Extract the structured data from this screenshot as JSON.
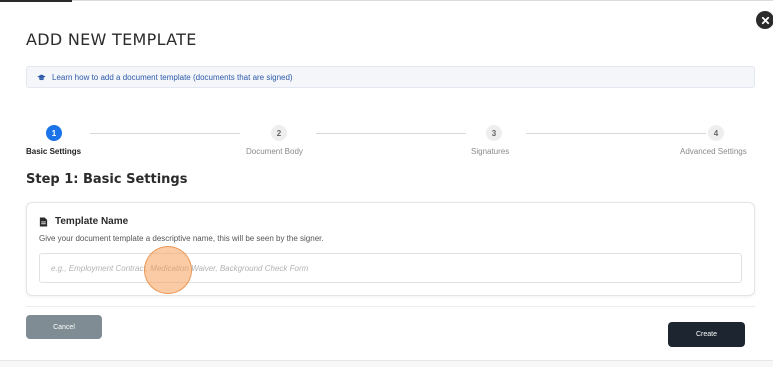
{
  "modal": {
    "title": "ADD NEW TEMPLATE",
    "help_link": "Learn how to add a document template (documents that are signed)"
  },
  "stepper": {
    "steps": [
      {
        "number": "1",
        "label": "Basic Settings",
        "active": true
      },
      {
        "number": "2",
        "label": "Document Body",
        "active": false
      },
      {
        "number": "3",
        "label": "Signatures",
        "active": false
      },
      {
        "number": "4",
        "label": "Advanced Settings",
        "active": false
      }
    ]
  },
  "step_heading": "Step 1: Basic Settings",
  "template_name_card": {
    "title": "Template Name",
    "description": "Give your document template a descriptive name, this will be seen by the signer.",
    "input_value": "",
    "input_placeholder": "e.g., Employment Contract, Medication Waiver, Background Check Form"
  },
  "footer": {
    "cancel_label": "Cancel",
    "create_label": "Create"
  },
  "colors": {
    "accent": "#1a73e8",
    "primary_button": "#1c2530",
    "secondary_button": "#7f8c93",
    "link": "#2e5aa8"
  },
  "icons": {
    "close": "close-icon",
    "banner": "graduation-cap-icon",
    "card": "document-icon"
  }
}
